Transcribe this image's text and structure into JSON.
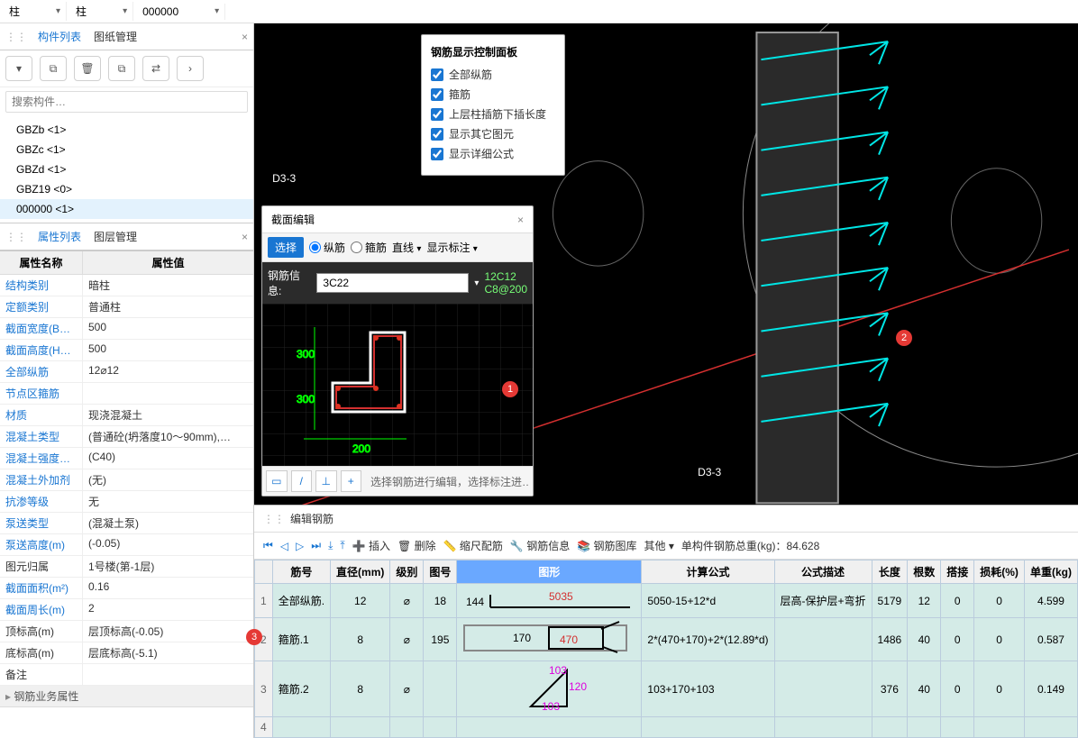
{
  "top": {
    "dd1": "柱",
    "dd2": "柱",
    "dd3": "000000"
  },
  "tabs_top": {
    "list_tab": "构件列表",
    "drawing_tab": "图纸管理"
  },
  "toolbar_icons": [
    "new",
    "copy",
    "delete",
    "dup",
    "switch",
    "more"
  ],
  "search_placeholder": "搜索构件…",
  "tree": [
    {
      "label": "GBZb <1>"
    },
    {
      "label": "GBZc <1>"
    },
    {
      "label": "GBZd <1>"
    },
    {
      "label": "GBZ19 <0>"
    },
    {
      "label": "000000 <1>",
      "selected": true
    }
  ],
  "tabs_prop": {
    "prop_tab": "属性列表",
    "layer_tab": "图层管理"
  },
  "prop_head": {
    "name": "属性名称",
    "value": "属性值"
  },
  "props": [
    {
      "k": "结构类别",
      "v": "暗柱"
    },
    {
      "k": "定额类别",
      "v": "普通柱"
    },
    {
      "k": "截面宽度(B…",
      "v": "500"
    },
    {
      "k": "截面高度(H…",
      "v": "500"
    },
    {
      "k": "全部纵筋",
      "v": "12⌀12"
    },
    {
      "k": "节点区箍筋",
      "v": ""
    },
    {
      "k": "材质",
      "v": "现浇混凝土"
    },
    {
      "k": "混凝土类型",
      "v": "(普通砼(坍落度10～90mm),…"
    },
    {
      "k": "混凝土强度…",
      "v": "(C40)"
    },
    {
      "k": "混凝土外加剂",
      "v": "(无)"
    },
    {
      "k": "抗渗等级",
      "v": "无"
    },
    {
      "k": "泵送类型",
      "v": "(混凝土泵)"
    },
    {
      "k": "泵送高度(m)",
      "v": "(-0.05)"
    },
    {
      "k": "图元归属",
      "v": "1号楼(第-1层)",
      "gray": true
    },
    {
      "k": "截面面积(m²)",
      "v": "0.16"
    },
    {
      "k": "截面周长(m)",
      "v": "2"
    },
    {
      "k": "顶标高(m)",
      "v": "层顶标高(-0.05)",
      "gray": true
    },
    {
      "k": "底标高(m)",
      "v": "层底标高(-5.1)",
      "gray": true
    },
    {
      "k": "备注",
      "v": "",
      "gray": true
    }
  ],
  "prop_section": "钢筋业务属性",
  "rebar_panel": {
    "title": "钢筋显示控制面板",
    "items": [
      "全部纵筋",
      "箍筋",
      "上层柱插筋下插长度",
      "显示其它图元",
      "显示详细公式"
    ]
  },
  "section_editor": {
    "title": "截面编辑",
    "select": "选择",
    "r1": "纵筋",
    "r2": "箍筋",
    "dd": "直线",
    "show": "显示标注",
    "info_label": "钢筋信息:",
    "info_value": "3C22",
    "side_a": "12C12",
    "side_b": "C8@200",
    "dim300a": "300",
    "dim300b": "300",
    "dim200": "200",
    "hint": "选择钢筋进行编辑，选择标注进…",
    "badge": "1"
  },
  "viewport": {
    "label_top": "D3-3",
    "label_bot": "D3-3",
    "badge": "2"
  },
  "bottom": {
    "title": "编辑钢筋",
    "tools": {
      "insert": "插入",
      "delete": "删除",
      "scale": "缩尺配筋",
      "info": "钢筋信息",
      "lib": "钢筋图库",
      "other": "其他",
      "total_label": "单构件钢筋总重(kg)：",
      "total_value": "84.628"
    },
    "cols": [
      "",
      "筋号",
      "直径(mm)",
      "级别",
      "图号",
      "图形",
      "计算公式",
      "公式描述",
      "长度",
      "根数",
      "搭接",
      "损耗(%)",
      "单重(kg)"
    ],
    "rows": [
      {
        "idx": "1",
        "name": "全部纵筋.",
        "dia": "12",
        "lvl": "⌀",
        "fig": "18",
        "shape": {
          "t": "line",
          "a": "144",
          "b": "5035"
        },
        "formula": "5050-15+12*d",
        "desc": "层高-保护层+弯折",
        "len": "5179",
        "cnt": "12",
        "lap": "0",
        "loss": "0",
        "wt": "4.599"
      },
      {
        "idx": "2",
        "name": "箍筋.1",
        "dia": "8",
        "lvl": "⌀",
        "fig": "195",
        "shape": {
          "t": "rect",
          "a": "170",
          "b": "470"
        },
        "formula": "2*(470+170)+2*(12.89*d)",
        "desc": "",
        "len": "1486",
        "cnt": "40",
        "lap": "0",
        "loss": "0",
        "wt": "0.587"
      },
      {
        "idx": "3",
        "name": "箍筋.2",
        "dia": "8",
        "lvl": "⌀",
        "fig": "",
        "shape": {
          "t": "tri",
          "a": "103",
          "b": "120",
          "c": "103"
        },
        "formula": "103+170+103",
        "desc": "",
        "len": "376",
        "cnt": "40",
        "lap": "0",
        "loss": "0",
        "wt": "0.149"
      },
      {
        "idx": "4",
        "name": "",
        "dia": "",
        "lvl": "",
        "fig": "",
        "shape": {
          "t": ""
        },
        "formula": "",
        "desc": "",
        "len": "",
        "cnt": "",
        "lap": "",
        "loss": "",
        "wt": ""
      }
    ],
    "marker3": "3"
  }
}
